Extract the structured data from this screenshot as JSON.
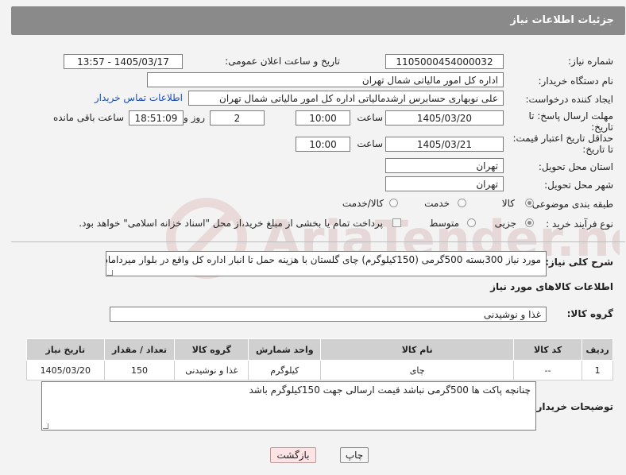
{
  "header": {
    "title": "جزئیات اطلاعات نیاز"
  },
  "form": {
    "need_number_label": "شماره نیاز:",
    "need_number": "1105000454000032",
    "announce_label": "تاریخ و ساعت اعلان عمومی:",
    "announce_value": "1405/03/17 - 13:57",
    "buyer_label": "نام دستگاه خریدار:",
    "buyer_value": "اداره کل امور مالیاتی شمال تهران",
    "creator_label": "ایجاد کننده درخواست:",
    "creator_value": "علی نوبهاری حسابرس ارشدمالیاتی اداره کل امور مالیاتی شمال تهران",
    "contact_link": "اطلاعات تماس خریدار",
    "reply_label_1": "مهلت ارسال پاسخ: تا",
    "reply_label_2": "تاریخ:",
    "reply_date": "1405/03/20",
    "time_label": "ساعت",
    "reply_time": "10:00",
    "days_value": "2",
    "days_label": "روز و",
    "remain_time": "18:51:09",
    "remain_label": "ساعت باقی مانده",
    "price_label_1": "حداقل تاریخ اعتبار قیمت:",
    "price_label_2": "تا تاریخ:",
    "price_date": "1405/03/21",
    "price_time": "10:00",
    "province_label": "استان محل تحویل:",
    "province_value": "تهران",
    "city_label": "شهر محل تحویل:",
    "city_value": "تهران",
    "category_label": "طبقه بندی موضوعی:",
    "category_options": [
      "کالا",
      "خدمت",
      "کالا/خدمت"
    ],
    "category_selected": "کالا",
    "process_label": "نوع فرآیند خرید :",
    "process_options": [
      "جزیی",
      "متوسط"
    ],
    "process_selected": "جزیی",
    "payment_note": "پرداخت تمام یا بخشی از مبلغ خرید،از محل \"اسناد خزانه اسلامی\" خواهد بود.",
    "desc_label": "شرح کلی نیاز:",
    "desc_value": "مورد نیاز 300بسته 500گرمی (150کیلوگرم) چای گلستان با هزینه حمل تا انبار اداره کل واقع در بلوار میرداماد"
  },
  "goods": {
    "section_title": "اطلاعات کالاهای مورد نیاز",
    "group_label": "گروه کالا:",
    "group_value": "غذا و نوشیدنی",
    "columns": [
      "ردیف",
      "کد کالا",
      "نام کالا",
      "واحد شمارش",
      "گروه کالا",
      "تعداد / مقدار",
      "تاریخ نیاز"
    ],
    "rows": [
      {
        "row": "1",
        "code": "--",
        "name": "چای",
        "unit": "کیلوگرم",
        "group": "غذا و نوشیدنی",
        "qty": "150",
        "date": "1405/03/20"
      }
    ]
  },
  "notes": {
    "label": "توضیحات خریدار:",
    "value": "چنانچه پاکت ها 500گرمی نباشد قیمت ارسالی جهت 150کیلوگرم باشد"
  },
  "buttons": {
    "print": "چاپ",
    "back": "بازگشت"
  },
  "watermark": {
    "text": "AriaTender.net"
  }
}
